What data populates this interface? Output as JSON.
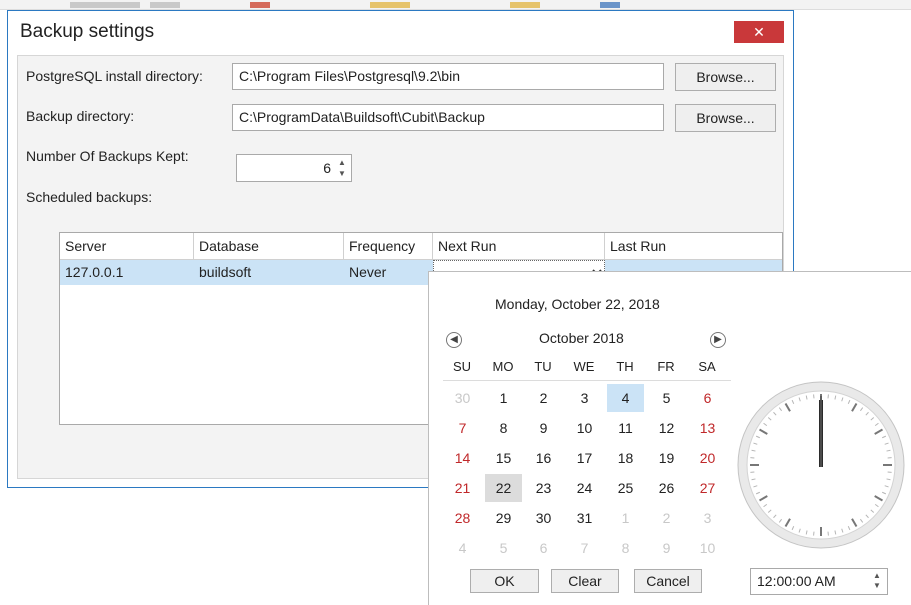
{
  "dialog": {
    "title": "Backup settings",
    "close_label": "✕"
  },
  "form": {
    "postgres_label": "PostgreSQL install directory:",
    "postgres_value": "C:\\Program Files\\Postgresql\\9.2\\bin",
    "backup_label": "Backup directory:",
    "backup_value": "C:\\ProgramData\\Buildsoft\\Cubit\\Backup",
    "browse_label": "Browse...",
    "kept_label": "Number Of Backups Kept:",
    "kept_value": "6",
    "scheduled_label": "Scheduled backups:"
  },
  "grid": {
    "columns": [
      "Server",
      "Database",
      "Frequency",
      "Next Run",
      "Last Run"
    ],
    "rows": [
      {
        "server": "127.0.0.1",
        "database": "buildsoft",
        "frequency": "Never",
        "next_run": "",
        "last_run": ""
      }
    ]
  },
  "calendar": {
    "today_text": "Monday, October 22, 2018",
    "month_label": "October 2018",
    "weekdays": [
      "SU",
      "MO",
      "TU",
      "WE",
      "TH",
      "FR",
      "SA"
    ],
    "weeks": [
      [
        "30",
        "1",
        "2",
        "3",
        "4",
        "5",
        "6"
      ],
      [
        "7",
        "8",
        "9",
        "10",
        "11",
        "12",
        "13"
      ],
      [
        "14",
        "15",
        "16",
        "17",
        "18",
        "19",
        "20"
      ],
      [
        "21",
        "22",
        "23",
        "24",
        "25",
        "26",
        "27"
      ],
      [
        "28",
        "29",
        "30",
        "31",
        "1",
        "2",
        "3"
      ],
      [
        "4",
        "5",
        "6",
        "7",
        "8",
        "9",
        "10"
      ]
    ],
    "highlighted_day": "4",
    "selected_day": "22",
    "ok_label": "OK",
    "clear_label": "Clear",
    "cancel_label": "Cancel",
    "time_value": "12:00:00 AM"
  },
  "icons": {
    "prev": "chevron-left-circle-icon",
    "next": "chevron-right-circle-icon",
    "dropdown": "chevron-down-icon",
    "spin": "spin-updown-icon"
  },
  "colors": {
    "title_border": "#2b79c2",
    "close": "#c9383a",
    "selection": "#cbe3f6",
    "weekend": "#c0282a"
  }
}
